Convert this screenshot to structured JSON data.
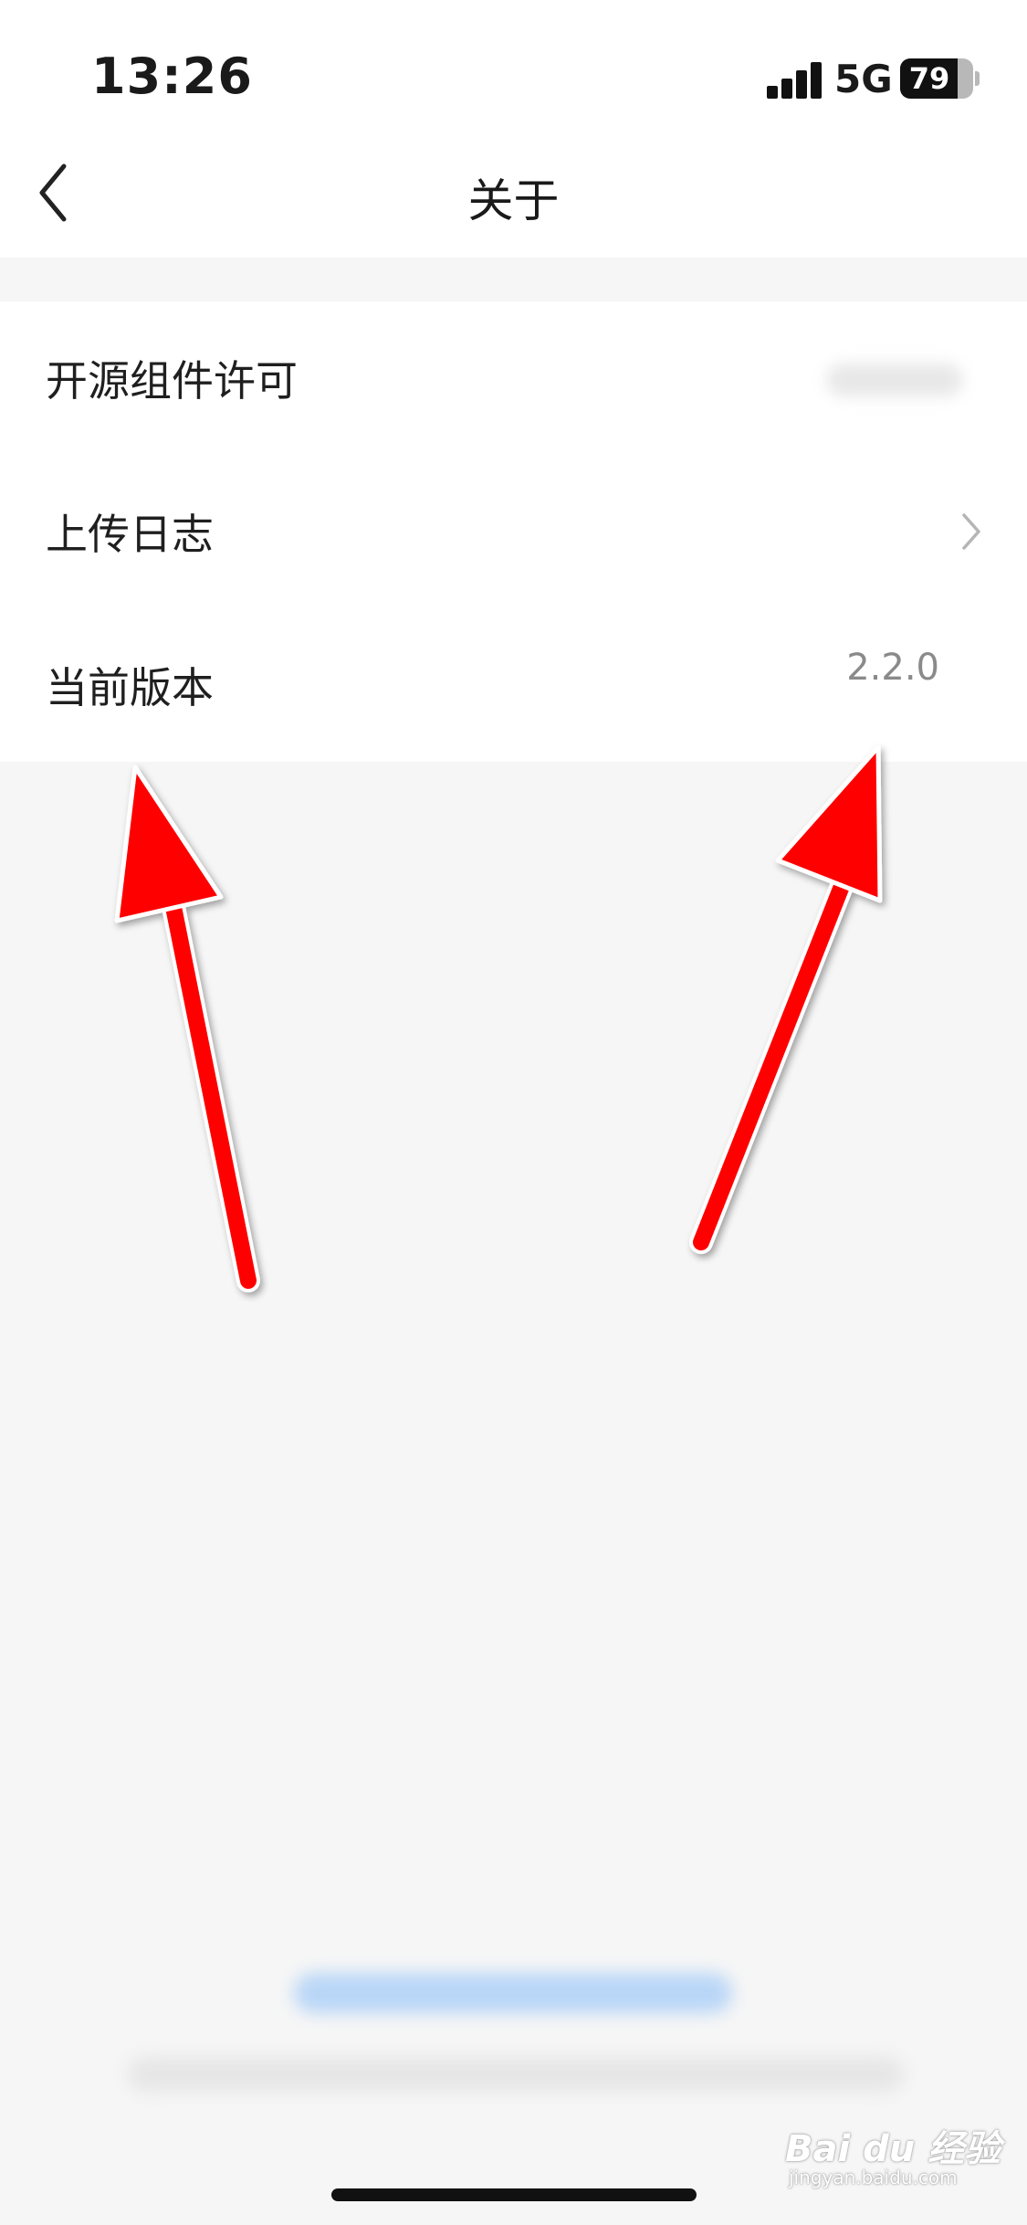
{
  "status_bar": {
    "time": "13:26",
    "network": "5G",
    "battery_level": "79",
    "battery_fraction": 0.79
  },
  "nav": {
    "title": "关于",
    "back_icon": "chevron-left-icon"
  },
  "list": {
    "items": [
      {
        "label": "开源组件许可",
        "value": "",
        "trailing": "blurred-value"
      },
      {
        "label": "上传日志",
        "value": "",
        "trailing": "chevron-right-icon"
      },
      {
        "label": "当前版本",
        "value": "2.2.0",
        "trailing": "text-value"
      }
    ]
  },
  "annotations": {
    "arrow_color": "#ff0000",
    "arrow_count": 2
  },
  "watermark": {
    "brand": "Bai du 经验",
    "sub": "jingyan.baidu.com"
  },
  "colors": {
    "background": "#f6f6f6",
    "surface": "#ffffff",
    "secondary_text": "#8a8a8a",
    "link_blur": "#b9d6f7"
  }
}
